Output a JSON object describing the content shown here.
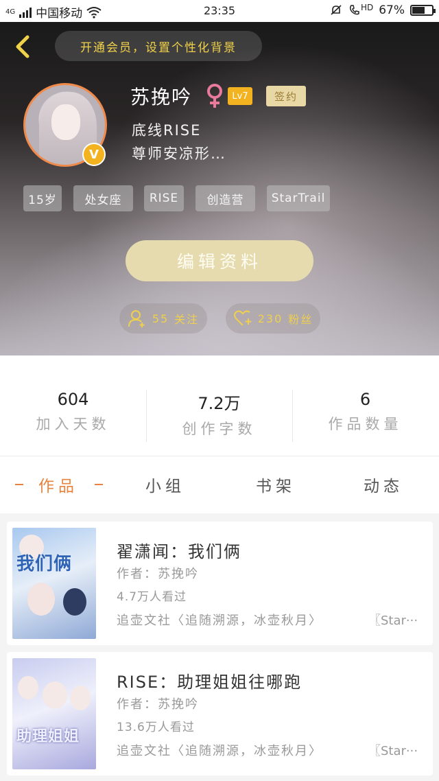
{
  "status_bar": {
    "network_type": "4G",
    "carrier": "中国移动",
    "time": "23:35",
    "hd_label": "HD",
    "battery_percent": "67%",
    "battery_level": 0.67
  },
  "profile": {
    "vip_banner": "开通会员，设置个性化背景",
    "name": "苏挽吟",
    "gender_symbol": "♀",
    "level": "Lv7",
    "signed_badge": "签约",
    "verified_badge": "V",
    "bio_line1": "底线RISE",
    "bio_line2": "尊师安凉形…",
    "tags": [
      "15岁",
      "处女座",
      "RISE",
      "创造营",
      "StarTrail"
    ],
    "edit_button": "编辑资料",
    "following_count": "55",
    "following_label": "关注",
    "followers_count": "230",
    "followers_label": "粉丝"
  },
  "stats": [
    {
      "value": "604",
      "label": "加入天数"
    },
    {
      "value": "7.2万",
      "label": "创作字数"
    },
    {
      "value": "6",
      "label": "作品数量"
    }
  ],
  "tabs": [
    "作品",
    "小组",
    "书架",
    "动态"
  ],
  "active_tab": "作品",
  "works": [
    {
      "title": "翟潇闻：我们俩",
      "author": "作者：苏挽吟",
      "views": "4.7万人看过",
      "club": "追壶文社〈追随溯源，冰壶秋月〉",
      "more": "〖Star···",
      "cover_text": "我们俩"
    },
    {
      "title": "RISE：助理姐姐往哪跑",
      "author": "作者：苏挽吟",
      "views": "13.6万人看过",
      "club": "追壶文社〈追随溯源，冰壶秋月〉",
      "more": "〖Star···",
      "cover_text": "助理姐姐"
    }
  ],
  "colors": {
    "accent_orange": "#e8833f",
    "gold_text": "#efd04d",
    "edit_button_bg": "#e6dbaf",
    "level_badge": "#f3b320"
  }
}
